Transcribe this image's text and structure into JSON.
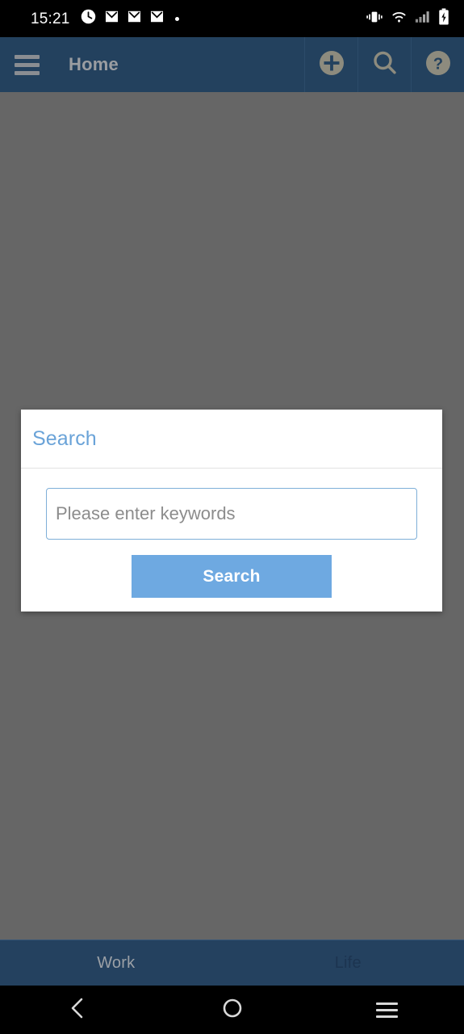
{
  "status_bar": {
    "time": "15:21",
    "left_icons": [
      "alarm-clock-icon",
      "mail-icon",
      "mail-icon",
      "mail-icon",
      "notification-dot-icon"
    ],
    "right_icons": [
      "vibrate-icon",
      "wifi-icon",
      "cellular-signal-icon",
      "battery-charging-icon"
    ],
    "background_color": "#000000",
    "foreground_color": "#ffffff"
  },
  "app_bar": {
    "title": "Home",
    "menu_icon": "hamburger-menu-icon",
    "actions": [
      {
        "name": "add-button",
        "icon": "plus-circle-icon"
      },
      {
        "name": "search-button",
        "icon": "search-icon"
      },
      {
        "name": "help-button",
        "icon": "help-circle-icon"
      }
    ],
    "background_color": "#23415e",
    "title_color": "#9a9da1"
  },
  "overlay": {
    "scrim_color": "#666666"
  },
  "dialog": {
    "title": "Search",
    "title_color": "#6aa3d8",
    "input": {
      "value": "",
      "placeholder": "Please enter keywords",
      "border_color": "#7eafd8",
      "placeholder_color": "#8c8c8c"
    },
    "submit_label": "Search",
    "submit_color": "#6ea9e1",
    "background_color": "#ffffff"
  },
  "bottom_tabs": {
    "background_color": "#24415f",
    "items": [
      {
        "label": "Work",
        "state": "active"
      },
      {
        "label": "Life",
        "state": "inactive"
      }
    ]
  },
  "nav_bar": {
    "background_color": "#000000",
    "buttons": [
      {
        "name": "nav-back-button",
        "icon": "chevron-left-icon"
      },
      {
        "name": "nav-home-button",
        "icon": "circle-icon"
      },
      {
        "name": "nav-recents-button",
        "icon": "hamburger-menu-icon"
      }
    ]
  }
}
